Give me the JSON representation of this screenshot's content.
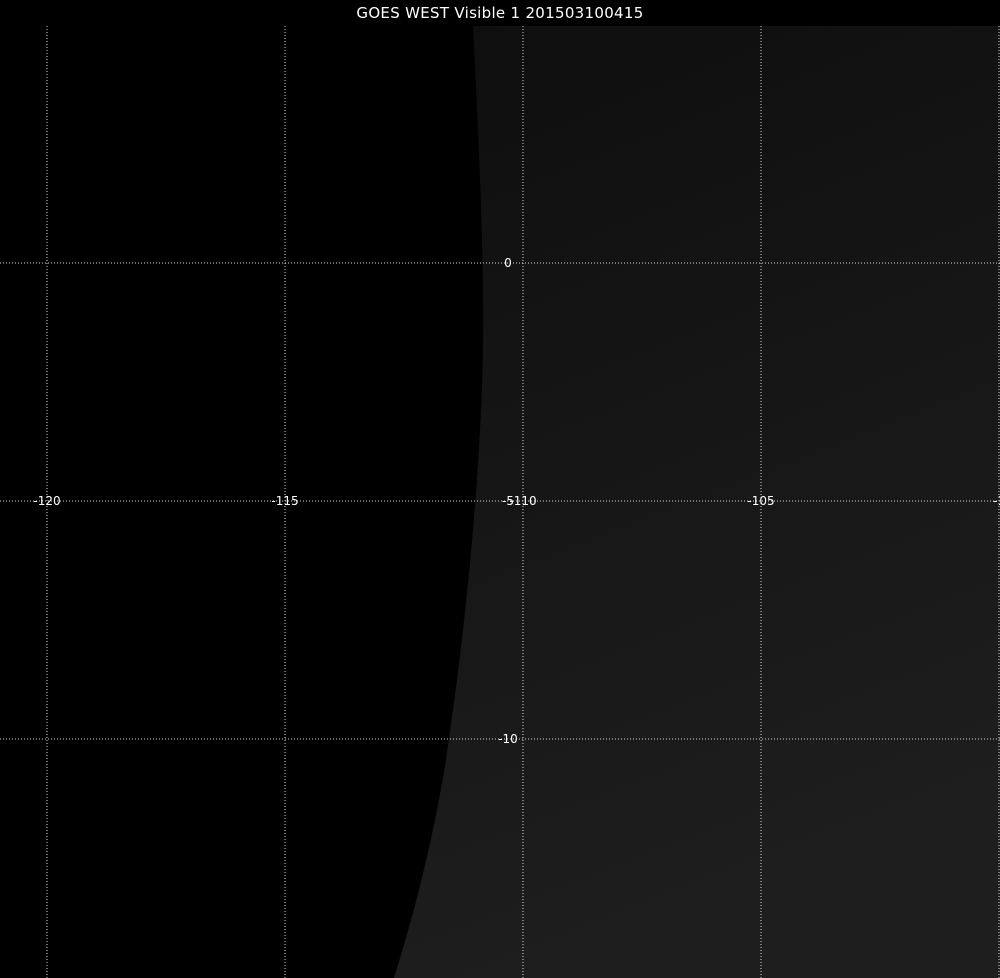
{
  "title": "GOES WEST Visible 1 201503100415",
  "map": {
    "projection": "lon-lat grid",
    "extent": {
      "lon": [
        -121,
        -100
      ],
      "lat": [
        -15,
        5
      ]
    },
    "earth_disk_edge_visible": true,
    "longitude_lines": [
      {
        "lon": -120,
        "label": "-120"
      },
      {
        "lon": -115,
        "label": "-115"
      },
      {
        "lon": -110,
        "label": "-110"
      },
      {
        "lon": -105,
        "label": "-105"
      },
      {
        "lon": -100,
        "label": "-1"
      }
    ],
    "latitude_lines": [
      {
        "lat": 0,
        "label": "0"
      },
      {
        "lat": -5,
        "label": "-5"
      },
      {
        "lat": -10,
        "label": "-10"
      }
    ],
    "colors": {
      "space": "#000000",
      "earth_dark": "#0e0e0e",
      "earth_light": "#1e1e1e",
      "grid": "#ffffff"
    }
  }
}
